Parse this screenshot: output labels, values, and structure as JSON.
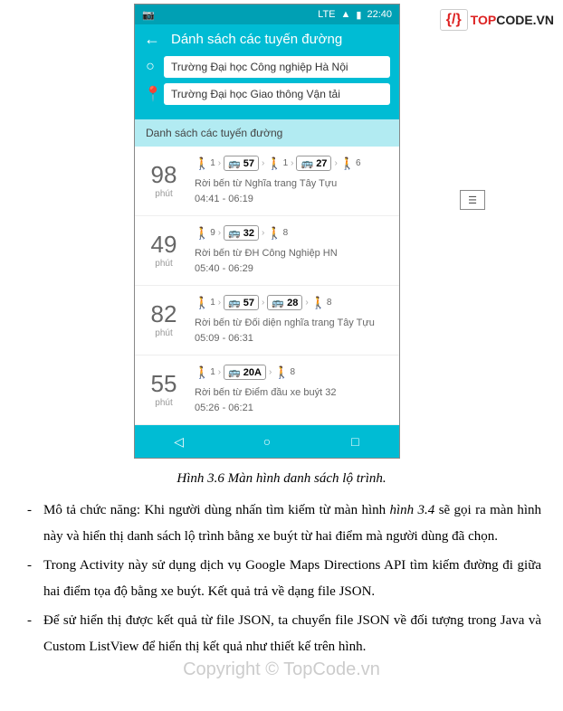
{
  "logo": {
    "icon": "{/}",
    "red": "TOP",
    "black": "CODE.VN"
  },
  "statusbar": {
    "lte": "LTE",
    "wifi": "▲",
    "batt": "▮",
    "time": "22:40"
  },
  "header": {
    "title": "Dánh sách các tuyến đường",
    "origin": "Trường Đại học Công nghiệp Hà Nội",
    "dest": "Trường Đại học Giao thông Vận tải"
  },
  "section_label": "Danh sách các tuyến đường",
  "routes": [
    {
      "minutes": "98",
      "unit": "phút",
      "steps": [
        {
          "t": "walk",
          "n": "1"
        },
        {
          "t": "chev"
        },
        {
          "t": "bus",
          "n": "57"
        },
        {
          "t": "chev"
        },
        {
          "t": "walk",
          "n": "1"
        },
        {
          "t": "chev"
        },
        {
          "t": "bus",
          "n": "27"
        },
        {
          "t": "chev"
        },
        {
          "t": "walk",
          "n": "6"
        }
      ],
      "desc1": "Rời bến từ Nghĩa trang Tây Tựu",
      "desc2": "04:41 - 06:19"
    },
    {
      "minutes": "49",
      "unit": "phút",
      "steps": [
        {
          "t": "walk",
          "n": "9"
        },
        {
          "t": "chev"
        },
        {
          "t": "bus",
          "n": "32"
        },
        {
          "t": "chev"
        },
        {
          "t": "walk",
          "n": "8"
        }
      ],
      "desc1": "Rời bến từ ĐH Công Nghiệp HN",
      "desc2": "05:40 - 06:29"
    },
    {
      "minutes": "82",
      "unit": "phút",
      "steps": [
        {
          "t": "walk",
          "n": "1"
        },
        {
          "t": "chev"
        },
        {
          "t": "bus",
          "n": "57"
        },
        {
          "t": "chev"
        },
        {
          "t": "bus",
          "n": "28"
        },
        {
          "t": "chev"
        },
        {
          "t": "walk",
          "n": "8"
        }
      ],
      "desc1": "Rời bến từ Đối diện nghĩa trang Tây Tựu",
      "desc2": "05:09 - 06:31"
    },
    {
      "minutes": "55",
      "unit": "phút",
      "steps": [
        {
          "t": "walk",
          "n": "1"
        },
        {
          "t": "chev"
        },
        {
          "t": "bus",
          "n": "20A"
        },
        {
          "t": "chev"
        },
        {
          "t": "walk",
          "n": "8"
        }
      ],
      "desc1": "Rời bến từ Điểm đầu xe buýt 32",
      "desc2": "05:26 - 06:21"
    }
  ],
  "caption": "Hình 3.6 Màn hình danh sách lộ trình.",
  "paragraphs": [
    {
      "pre": "Mô tả chức năng: Khi người dùng nhấn tìm kiếm từ màn hình ",
      "ital": "hình 3.4",
      "post": " sẽ gọi ra màn hình này và hiển thị danh sách lộ trình bằng xe buýt từ hai điểm mà người dùng đã chọn."
    },
    {
      "pre": "Trong Activity này sử dụng dịch vụ Google Maps Directions API tìm kiếm đường đi giữa hai điểm tọa độ bằng xe buýt. Kết quả trả về dạng file JSON.",
      "ital": "",
      "post": ""
    },
    {
      "pre": "Để sử hiển thị được kết quả từ file JSON, ta chuyển file JSON về đối tượng trong Java và Custom ListView để hiển thị kết quả như thiết kế trên hình.",
      "ital": "",
      "post": ""
    }
  ],
  "watermark": "Copyright © TopCode.vn"
}
